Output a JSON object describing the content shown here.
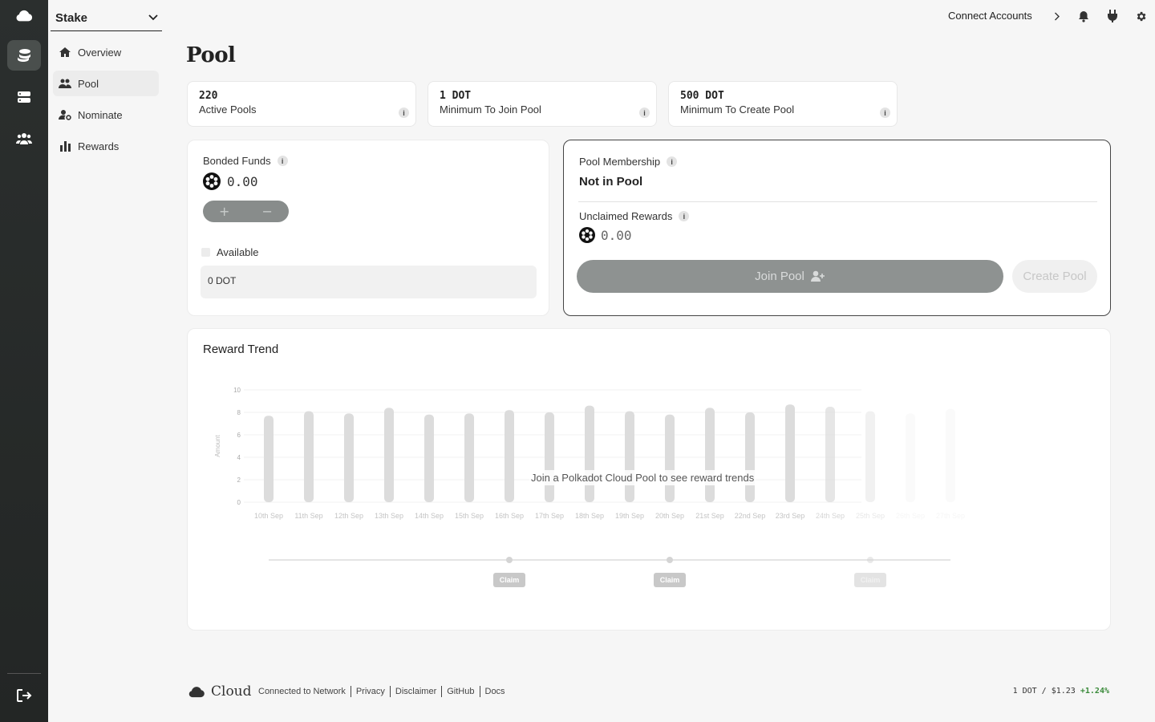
{
  "sidebar": {
    "network_select": "Stake",
    "items": [
      {
        "label": "Overview"
      },
      {
        "label": "Pool"
      },
      {
        "label": "Nominate"
      },
      {
        "label": "Rewards"
      }
    ]
  },
  "topbar": {
    "connect_label": "Connect Accounts"
  },
  "page": {
    "title": "Pool"
  },
  "stats": [
    {
      "value": "220",
      "label": "Active Pools"
    },
    {
      "value": "1 DOT",
      "label": "Minimum To Join Pool"
    },
    {
      "value": "500 DOT",
      "label": "Minimum To Create Pool"
    }
  ],
  "bonded": {
    "title": "Bonded Funds",
    "amount": "0.00",
    "available_label": "Available",
    "available_value": "0 DOT"
  },
  "membership": {
    "title": "Pool Membership",
    "status": "Not in Pool",
    "unclaimed_title": "Unclaimed Rewards",
    "unclaimed_amount": "0.00",
    "join_label": "Join Pool",
    "create_label": "Create Pool"
  },
  "trend": {
    "title": "Reward Trend",
    "overlay": "Join a Polkadot Cloud Pool to see reward trends",
    "claim_label": "Claim"
  },
  "chart_data": {
    "type": "bar",
    "ylabel": "Amount",
    "ylim": [
      0,
      10
    ],
    "yticks": [
      0,
      2,
      4,
      6,
      8,
      10
    ],
    "categories": [
      "10th Sep",
      "11th Sep",
      "12th Sep",
      "13th Sep",
      "14th Sep",
      "15th Sep",
      "16th Sep",
      "17th Sep",
      "18th Sep",
      "19th Sep",
      "20th Sep",
      "21st Sep",
      "22nd Sep",
      "23rd Sep",
      "24th Sep",
      "25th Sep",
      "26th Sep",
      "27th Sep"
    ],
    "values": [
      7.7,
      8.1,
      7.9,
      8.4,
      7.8,
      7.9,
      8.2,
      8.0,
      8.6,
      8.1,
      7.8,
      8.4,
      8.0,
      8.7,
      8.5,
      8.1,
      7.9,
      8.3
    ],
    "claim_positions": [
      "16th Sep",
      "20th Sep",
      "25th Sep"
    ]
  },
  "footer": {
    "brand": "Cloud",
    "links": [
      "Connected to Network",
      "Privacy",
      "Disclaimer",
      "GitHub",
      "Docs"
    ],
    "price_pair": "1 DOT / $1.23",
    "price_change": "+1.24%"
  },
  "colors": {
    "rail_bg": "#2b2f2e",
    "positive": "#3a8a3a",
    "button_disabled": "#8e9291"
  }
}
